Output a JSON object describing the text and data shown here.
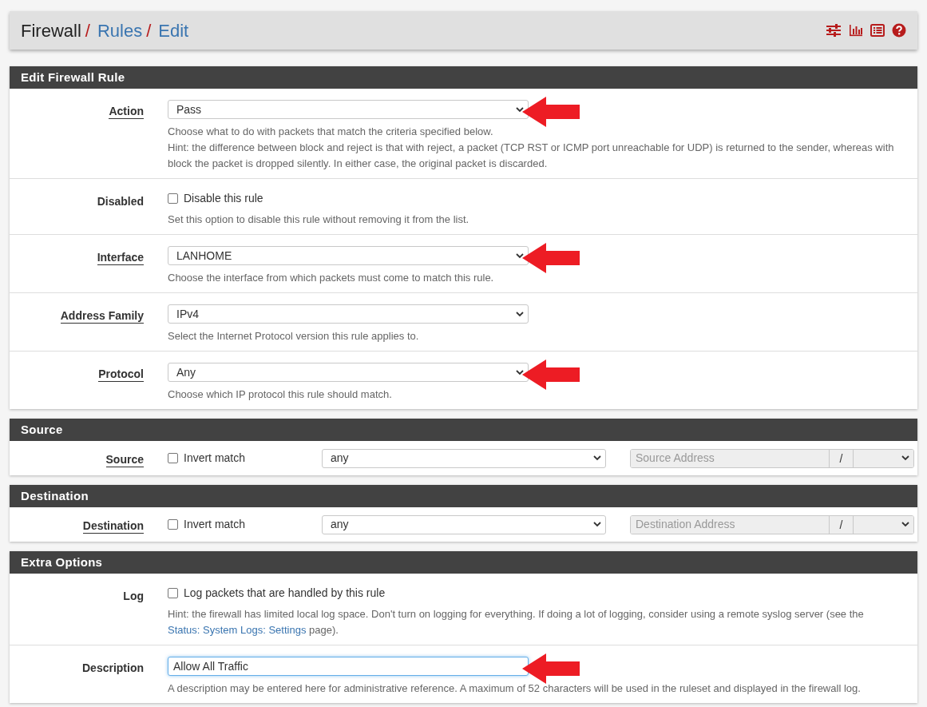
{
  "breadcrumb": [
    {
      "label": "Firewall",
      "link": false,
      "separator": "/"
    },
    {
      "label": "Rules",
      "link": true,
      "separator": "/"
    },
    {
      "label": "Edit",
      "link": true
    }
  ],
  "sections": [
    {
      "title": "Edit Firewall Rule",
      "rows": [
        {
          "kind": "select",
          "label": "Action",
          "label_link": true,
          "value": "Pass",
          "annotated": true,
          "hints": [
            [
              {
                "text": "Choose what to do with packets that match the criteria specified below.",
                "link": false
              }
            ],
            [
              {
                "text": "Hint: the difference between block and reject is that with reject, a packet (TCP RST or ICMP port unreachable for UDP) is returned to the sender, whereas with block the packet is dropped silently. In either case, the original packet is discarded.",
                "link": false
              }
            ]
          ]
        },
        {
          "kind": "checkbox",
          "label": "Disabled",
          "label_link": false,
          "checkbox_label": "Disable this rule",
          "checked": false,
          "hints": [
            [
              {
                "text": "Set this option to disable this rule without removing it from the list.",
                "link": false
              }
            ]
          ]
        },
        {
          "kind": "select",
          "label": "Interface",
          "label_link": true,
          "value": "LANHOME",
          "annotated": true,
          "hints": [
            [
              {
                "text": "Choose the interface from which packets must come to match this rule.",
                "link": false
              }
            ]
          ]
        },
        {
          "kind": "select",
          "label": "Address Family",
          "label_link": true,
          "value": "IPv4",
          "annotated": false,
          "hints": [
            [
              {
                "text": "Select the Internet Protocol version this rule applies to.",
                "link": false
              }
            ]
          ]
        },
        {
          "kind": "select",
          "label": "Protocol",
          "label_link": true,
          "value": "Any",
          "annotated": true,
          "hints": [
            [
              {
                "text": "Choose which IP protocol this rule should match.",
                "link": false
              }
            ]
          ]
        }
      ]
    },
    {
      "title": "Source",
      "rows": [
        {
          "kind": "address",
          "label": "Source",
          "label_link": true,
          "checkbox_label": "Invert match",
          "checked": false,
          "value": "any",
          "placeholder": "Source Address",
          "disabled": true,
          "separator": "/"
        }
      ]
    },
    {
      "title": "Destination",
      "rows": [
        {
          "kind": "address",
          "label": "Destination",
          "label_link": true,
          "checkbox_label": "Invert match",
          "checked": false,
          "value": "any",
          "placeholder": "Destination Address",
          "disabled": true,
          "separator": "/"
        }
      ]
    },
    {
      "title": "Extra Options",
      "rows": [
        {
          "kind": "checkbox",
          "label": "Log",
          "label_link": false,
          "checkbox_label": "Log packets that are handled by this rule",
          "checked": false,
          "hints": [
            [
              {
                "text": "Hint: the firewall has limited local log space. Don't turn on logging for everything. If doing a lot of logging, consider using a remote syslog server (see the ",
                "link": false
              },
              {
                "text": "Status: System Logs: Settings",
                "link": true
              },
              {
                "text": " page).",
                "link": false
              }
            ]
          ]
        },
        {
          "kind": "text",
          "label": "Description",
          "label_link": false,
          "value": "Allow All Traffic",
          "focused": true,
          "annotated": true,
          "hints": [
            [
              {
                "text": "A description may be entered here for administrative reference. A maximum of 52 characters will be used in the ruleset and displayed in the firewall log.",
                "link": false
              }
            ]
          ]
        }
      ]
    }
  ]
}
